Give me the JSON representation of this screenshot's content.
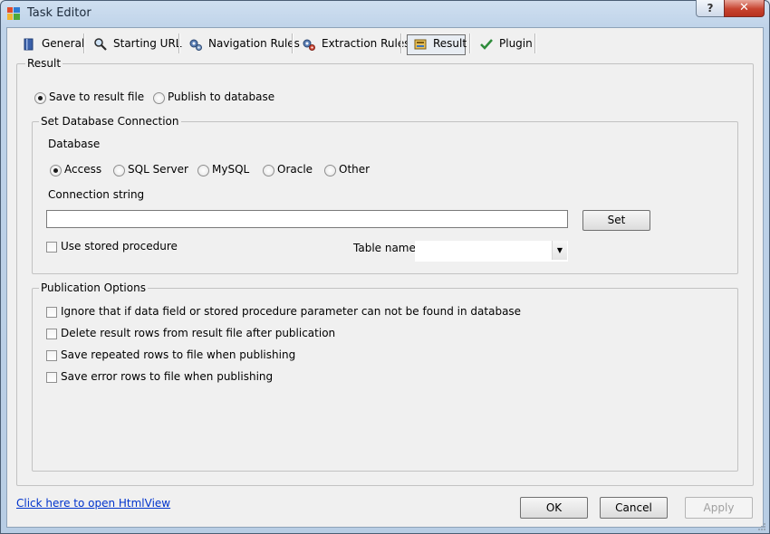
{
  "window": {
    "title": "Task Editor"
  },
  "titlebar": {
    "help_label": "?",
    "close_label": "✕"
  },
  "tabs": [
    {
      "label": "General",
      "icon": "book-icon"
    },
    {
      "label": "Starting URL",
      "icon": "magnifier-icon"
    },
    {
      "label": "Navigation Rules",
      "icon": "gears-icon"
    },
    {
      "label": "Extraction Rules",
      "icon": "gears-red-icon"
    },
    {
      "label": "Result",
      "icon": "result-icon",
      "selected": true
    },
    {
      "label": "Plugin",
      "icon": "checkmark-icon"
    }
  ],
  "result": {
    "group_label": "Result",
    "save_to_file": "Save to result file",
    "publish_to_db": "Publish to database",
    "selected_target": "Save to result file"
  },
  "db_connection": {
    "group_label": "Set Database Connection",
    "database_label": "Database",
    "databases": [
      "Access",
      "SQL Server",
      "MySQL",
      "Oracle",
      "Other"
    ],
    "selected_database": "Access",
    "connection_string_label": "Connection string",
    "connection_string_value": "",
    "set_button": "Set",
    "use_stored_procedure": "Use stored procedure",
    "use_stored_procedure_checked": false,
    "table_name_label": "Table name",
    "table_name_value": ""
  },
  "publication_options": {
    "group_label": "Publication Options",
    "options": [
      {
        "label": "Ignore that if data field or stored procedure parameter can not be found in database",
        "checked": false
      },
      {
        "label": "Delete result rows from result file after publication",
        "checked": false
      },
      {
        "label": "Save repeated rows to file when publishing",
        "checked": false
      },
      {
        "label": "Save error rows to file when publishing",
        "checked": false
      }
    ]
  },
  "footer": {
    "html_view_link": "Click here to open HtmlView",
    "ok": "OK",
    "cancel": "Cancel",
    "apply": "Apply"
  },
  "colors": {
    "link": "#0033cc",
    "close_button": "#c7432f",
    "client_background": "#f0f0f0"
  }
}
